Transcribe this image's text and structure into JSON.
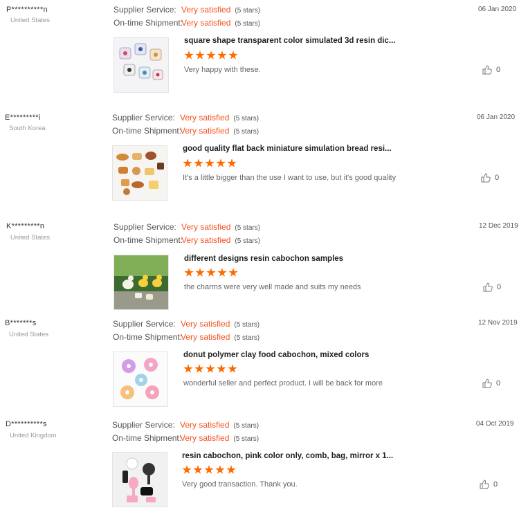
{
  "labels": {
    "supplier_service": "Supplier Service:",
    "ontime_shipment": "On-time Shipment:"
  },
  "colors": {
    "accent": "#f4511e",
    "star": "#ff6a00"
  },
  "reviews": [
    {
      "buyer": "P**********n",
      "country": "United States",
      "supplier_service": "Very satisfied",
      "supplier_stars": "(5 stars)",
      "shipment": "Very satisfied",
      "shipment_stars": "(5 stars)",
      "date": "06 Jan 2020",
      "product_title": "square shape transparent color simulated 3d resin dic...",
      "rating": 5,
      "comment": "Very happy with these.",
      "likes": "0",
      "image_icon": "resin-dice-photo"
    },
    {
      "buyer": "E*********i",
      "country": "South Korea",
      "supplier_service": "Very satisfied",
      "supplier_stars": "(5 stars)",
      "shipment": "Very satisfied",
      "shipment_stars": "(5 stars)",
      "date": "06 Jan 2020",
      "product_title": "good quality flat back miniature simulation bread resi...",
      "rating": 5,
      "comment": "It's a little bigger than the use I want to use, but it's good quality",
      "likes": "0",
      "image_icon": "miniature-bread-photo"
    },
    {
      "buyer": "K*********n",
      "country": "United States",
      "supplier_service": "Very satisfied",
      "supplier_stars": "(5 stars)",
      "shipment": "Very satisfied",
      "shipment_stars": "(5 stars)",
      "date": "12 Dec 2019",
      "product_title": "different designs resin cabochon samples",
      "rating": 5,
      "comment": "the charms were very well made and suits my needs",
      "likes": "0",
      "image_icon": "resin-ducks-photo"
    },
    {
      "buyer": "B*******s",
      "country": "United States",
      "supplier_service": "Very satisfied",
      "supplier_stars": "(5 stars)",
      "shipment": "Very satisfied",
      "shipment_stars": "(5 stars)",
      "date": "12 Nov 2019",
      "product_title": "donut polymer clay food cabochon, mixed colors",
      "rating": 5,
      "comment": "wonderful seller and perfect product. I will be back for more",
      "likes": "0",
      "image_icon": "donut-cabochon-photo"
    },
    {
      "buyer": "D**********s",
      "country": "United Kingdom",
      "supplier_service": "Very satisfied",
      "supplier_stars": "(5 stars)",
      "shipment": "Very satisfied",
      "shipment_stars": "(5 stars)",
      "date": "04 Oct 2019",
      "product_title": "resin cabochon, pink color only, comb, bag, mirror x 1...",
      "rating": 5,
      "comment": "Very good transaction. Thank you.",
      "likes": "0",
      "image_icon": "pink-accessories-photo"
    }
  ]
}
